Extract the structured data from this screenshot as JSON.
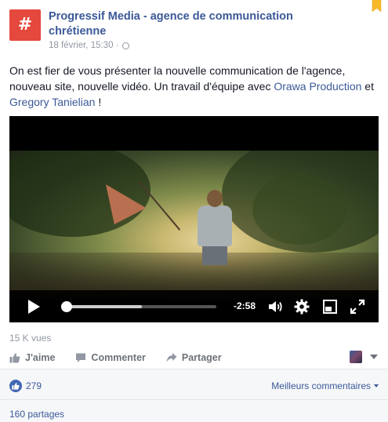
{
  "post": {
    "page_name": "Progressif Media - agence de communication chrétienne",
    "avatar_glyph": "#",
    "timestamp": "18 février, 15:30 ·",
    "text_intro": "On est fier de vous présenter la nouvelle communication de l'agence, nouveau site, nouvelle vidéo. Un travail d'équipe avec ",
    "link1": "Orawa Production",
    "text_mid": " et ",
    "link2": "Gregory Tanielian",
    "text_end": " !"
  },
  "video": {
    "time_remaining": "-2:58",
    "progress": 0.52,
    "icons": [
      "play-icon",
      "volume-icon",
      "settings-gear-icon",
      "theater-mode-icon",
      "fullscreen-icon"
    ]
  },
  "stats": {
    "views": "15 K vues",
    "like_label": "J'aime",
    "comment_label": "Commenter",
    "share_label": "Partager",
    "like_count": "279",
    "top_comments_label": "Meilleurs commentaires",
    "shares": "160 partages"
  },
  "colors": {
    "link": "#3b5998",
    "avatar": "#e5483c",
    "muted": "#9197a3"
  }
}
